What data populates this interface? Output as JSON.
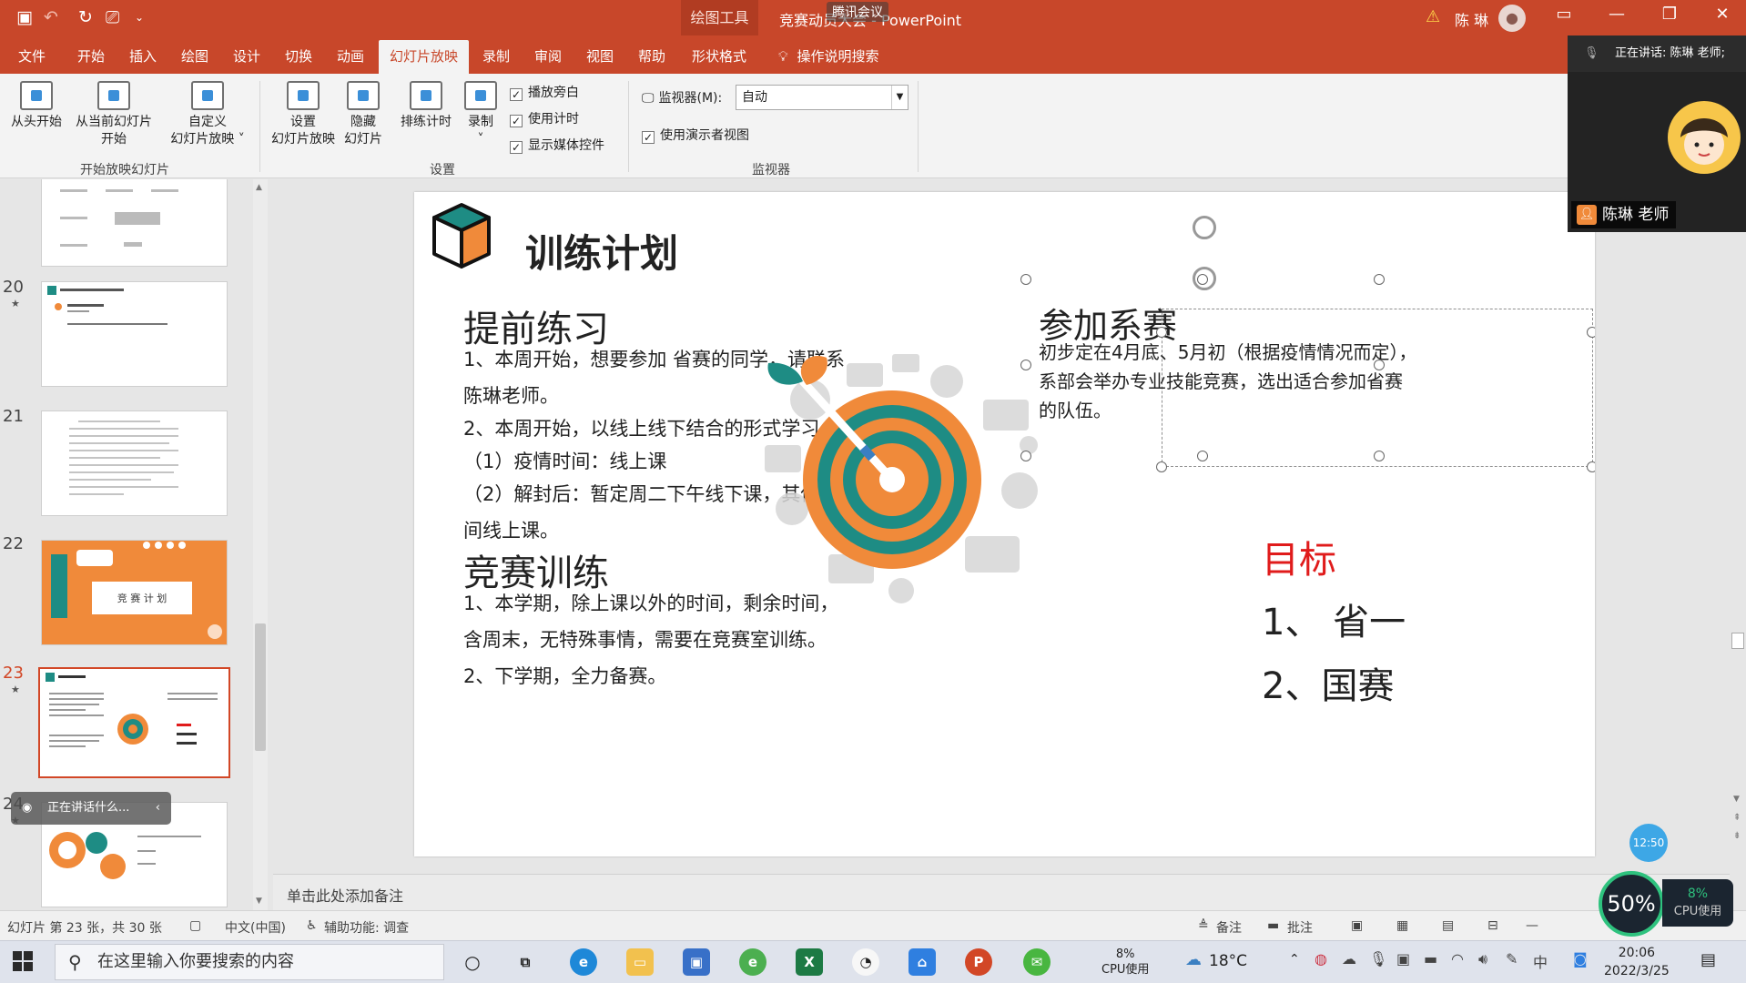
{
  "titlebar": {
    "context_tab": "绘图工具",
    "doc_title": "竞赛动员大会 - PowerPoint",
    "meeting_tag": "腾讯会议",
    "user_name": "陈 琳"
  },
  "ribbon_tabs": [
    "文件",
    "开始",
    "插入",
    "绘图",
    "设计",
    "切换",
    "动画",
    "幻灯片放映",
    "录制",
    "审阅",
    "视图",
    "帮助",
    "形状格式"
  ],
  "active_tab": "幻灯片放映",
  "tell_me": "操作说明搜索",
  "ribbon": {
    "from_beginning": "从头开始",
    "from_current_line1": "从当前幻灯片",
    "from_current_line2": "开始",
    "custom_line1": "自定义",
    "custom_line2": "幻灯片放映 ˅",
    "group_start": "开始放映幻灯片",
    "setup_line1": "设置",
    "setup_line2": "幻灯片放映",
    "hide_line1": "隐藏",
    "hide_line2": "幻灯片",
    "rehearse": "排练计时",
    "record": "录制",
    "record_arrow": "˅",
    "play_narration": "播放旁白",
    "use_timings": "使用计时",
    "show_media": "显示媒体控件",
    "group_setup": "设置",
    "monitor_label": "监视器(M):",
    "monitor_value": "自动",
    "presenter_view": "使用演示者视图",
    "group_monitors": "监视器"
  },
  "thumbnails": [
    {
      "number": "20",
      "star": "★"
    },
    {
      "number": "21",
      "star": ""
    },
    {
      "number": "22",
      "star": "",
      "text": "竞 赛 计 划"
    },
    {
      "number": "23",
      "star": "★"
    },
    {
      "number": "24",
      "star": "★"
    }
  ],
  "thumb_pill": "正在讲话什么...",
  "slide": {
    "title": "训练计划",
    "section1_title": "提前练习",
    "section1_lines": [
      "1、本周开始，想要参加 省赛的同学，请联系",
      "陈琳老师。",
      "2、本周开始，以线上线下结合的形式学习：",
      "（1）疫情时间：线上课",
      "（2）解封后：暂定周二下午线下课，其他时",
      "间线上课。"
    ],
    "section2_title": "竞赛训练",
    "section2_lines": [
      "1、本学期，除上课以外的时间，剩余时间，",
      "含周末，无特殊事情，需要在竞赛室训练。",
      "2、下学期，全力备赛。"
    ],
    "section3_title": "参加系赛",
    "section3_lines": [
      "初步定在4月底、5月初（根据疫情情况而定），",
      "系部会举办专业技能竞赛，选出适合参加省赛",
      "的队伍。"
    ],
    "goal_title": "目标",
    "goal_items": [
      "1、 省一",
      "2、国赛"
    ]
  },
  "notes_placeholder": "单击此处添加备注",
  "timer_badge": "12:50",
  "status": {
    "slide_info": "幻灯片 第 23 张，共 30 张",
    "language": "中文(中国)",
    "accessibility": "辅助功能: 调查",
    "notes": "备注",
    "comments": "批注"
  },
  "cpu_overlay": {
    "percent": "50%",
    "small": "8%",
    "label": "CPU使用"
  },
  "taskbar": {
    "search_placeholder": "在这里输入你要搜索的内容",
    "cpu_percent": "8%",
    "cpu_label": "CPU使用",
    "temperature": "18°C",
    "time": "20:06",
    "date": "2022/3/25"
  },
  "video": {
    "speaking": "正在讲话: 陈琳 老师;",
    "presenter_name": "陈琳 老师"
  },
  "colors": {
    "accent": "#c8472a",
    "orange": "#f08a3a",
    "teal": "#1e8c84",
    "goal_red": "#e01b1b"
  }
}
